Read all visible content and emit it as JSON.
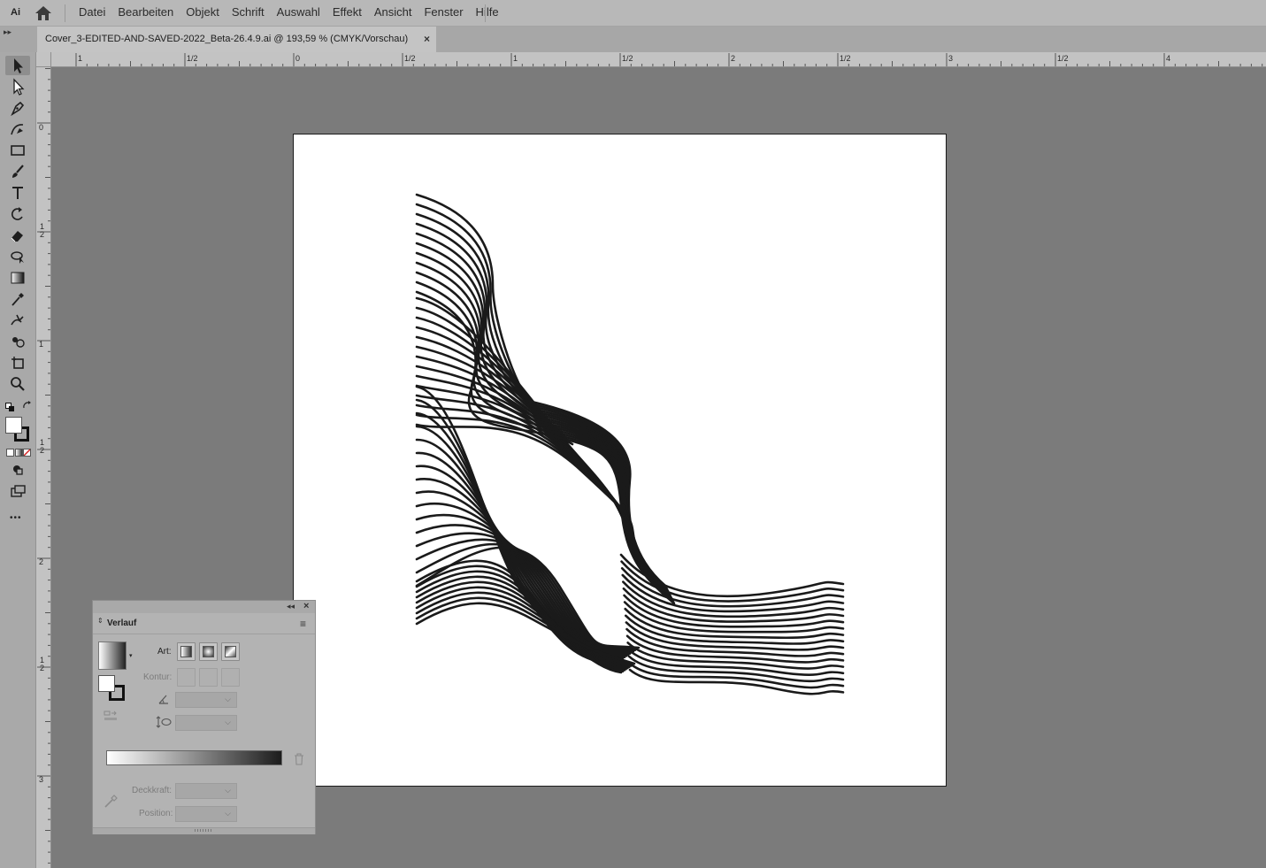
{
  "app": {
    "logo_text": "Ai"
  },
  "menu": {
    "items": [
      "Datei",
      "Bearbeiten",
      "Objekt",
      "Schrift",
      "Auswahl",
      "Effekt",
      "Ansicht",
      "Fenster",
      "Hilfe"
    ]
  },
  "document": {
    "tab_title": "Cover_3-EDITED-AND-SAVED-2022_Beta-26.4.9.ai @ 193,59 % (CMYK/Vorschau)",
    "close_symbol": "×"
  },
  "rulers": {
    "horizontal_labels": [
      "1",
      "1/2",
      "0",
      "1/2",
      "1",
      "1/2",
      "2",
      "1/2",
      "3",
      "1/2",
      "4"
    ],
    "vertical_labels": [
      "0",
      "1/2",
      "1",
      "1/2",
      "2",
      "1/2",
      "3"
    ]
  },
  "toolbar": {
    "tools": [
      "selection-tool",
      "direct-selection-tool",
      "pen-tool",
      "curvature-tool",
      "rectangle-tool",
      "paintbrush-tool",
      "type-tool",
      "rotate-tool",
      "eraser-tool",
      "shape-builder-tool",
      "gradient-tool",
      "eyedropper-tool",
      "puppet-warp-tool",
      "symbol-sprayer-tool",
      "artboard-tool",
      "zoom-tool"
    ],
    "more_symbol": "•••"
  },
  "gradient_panel": {
    "title": "Verlauf",
    "art_label": "Art:",
    "kontur_label": "Kontur:",
    "deckkraft_label": "Deckkraft:",
    "position_label": "Position:",
    "collapse_symbol": "◂◂",
    "close_symbol": "×",
    "menu_symbol": "≡",
    "sort_symbol": "⇕"
  },
  "colors": {
    "artwork_stroke": "#1a1a1a",
    "pasteboard": "#7b7b7b",
    "artboard": "#ffffff"
  }
}
